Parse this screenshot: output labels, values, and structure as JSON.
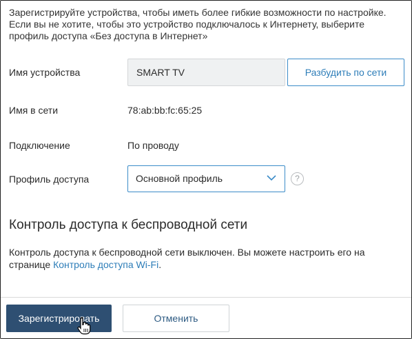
{
  "intro_text": "Зарегистрируйте устройства, чтобы иметь более гибкие возможности по настройке. Если вы не хотите, чтобы это устройство подключалось к Интернету, выберите профиль доступа «Без доступа в Интернет»",
  "device": {
    "name_label": "Имя устройства",
    "name_value": "SMART TV",
    "wake_button": "Разбудить по сети",
    "network_name_label": "Имя в сети",
    "network_name_value": "78:ab:bb:fc:65:25",
    "connection_label": "Подключение",
    "connection_value": "По проводу",
    "profile_label": "Профиль доступа",
    "profile_value": "Основной профиль",
    "help_symbol": "?"
  },
  "wifi_section": {
    "title": "Контроль доступа к беспроводной сети",
    "text": "Контроль доступа к беспроводной сети выключен. Вы можете настроить его на странице ",
    "link": "Контроль доступа Wi-Fi",
    "text_end": "."
  },
  "footer": {
    "register_button": "Зарегистрировать",
    "cancel_button": "Отменить"
  },
  "colors": {
    "primary_button": "#2e4f72",
    "accent_blue": "#2d7db8",
    "input_bg": "#eff1f2"
  },
  "icons": {
    "dropdown": "chevron-down-icon",
    "help": "help-icon",
    "cursor": "hand-pointer-icon"
  }
}
